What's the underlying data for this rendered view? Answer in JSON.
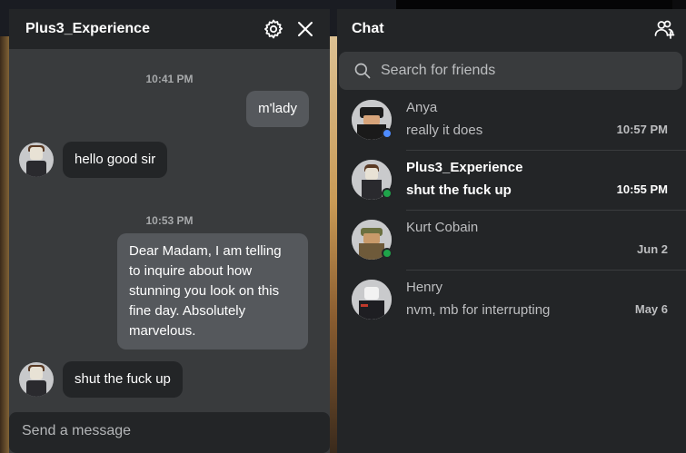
{
  "conversation": {
    "title": "Plus3_Experience",
    "messages": [
      {
        "type": "timestamp",
        "text": "10:41 PM"
      },
      {
        "type": "outgoing",
        "text": "m'lady"
      },
      {
        "type": "incoming",
        "text": "hello good sir"
      },
      {
        "type": "timestamp",
        "text": "10:53 PM"
      },
      {
        "type": "outgoing",
        "text": "Dear Madam, I am telling to inquire about how stunning you look on this fine day. Absolutely marvelous."
      },
      {
        "type": "incoming",
        "text": "shut the fuck up"
      }
    ],
    "input_placeholder": "Send a message"
  },
  "chat": {
    "title": "Chat",
    "search_placeholder": "Search for friends",
    "friends": [
      {
        "name": "Anya",
        "preview": "really it does",
        "time": "10:57 PM",
        "unread": false,
        "presence": "online",
        "presence_color": "#4e8cff"
      },
      {
        "name": "Plus3_Experience",
        "preview": "shut the fuck up",
        "time": "10:55 PM",
        "unread": true,
        "presence": "in-game",
        "presence_color": "#1fa34a"
      },
      {
        "name": "Kurt Cobain",
        "preview": "",
        "time": "Jun 2",
        "unread": false,
        "presence": "in-game",
        "presence_color": "#1fa34a"
      },
      {
        "name": "Henry",
        "preview": "nvm, mb for interrupting",
        "time": "May 6",
        "unread": false,
        "presence": "offline",
        "presence_color": ""
      }
    ]
  },
  "icons": {
    "settings": "gear-icon",
    "close": "close-icon",
    "add_friend": "add-friend-icon",
    "search": "search-icon"
  },
  "colors": {
    "panel_dark": "#232527",
    "panel_mid": "#393b3d",
    "bubble_out": "#55585c",
    "presence_online": "#4e8cff",
    "presence_ingame": "#1fa34a"
  }
}
